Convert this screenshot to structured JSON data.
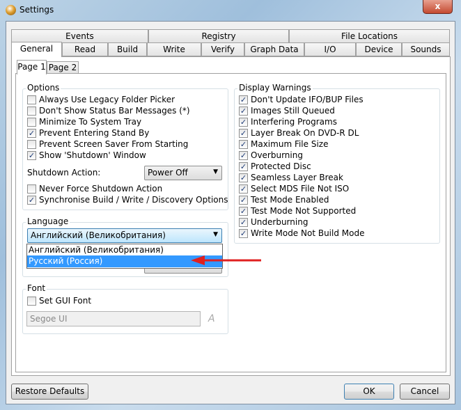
{
  "window": {
    "title": "Settings",
    "close_label": "x"
  },
  "tabs_row1": [
    "Events",
    "Registry",
    "File Locations"
  ],
  "tabs_row2": [
    "General",
    "Read",
    "Build",
    "Write",
    "Verify",
    "Graph Data",
    "I/O",
    "Device",
    "Sounds"
  ],
  "active_tab": "General",
  "subtabs": [
    "Page 1",
    "Page 2"
  ],
  "active_subtab": "Page 1",
  "options": {
    "title": "Options",
    "items": [
      {
        "label": "Always Use Legacy Folder Picker",
        "checked": false
      },
      {
        "label": "Don't Show Status Bar Messages (*)",
        "checked": false
      },
      {
        "label": "Minimize To System Tray",
        "checked": false
      },
      {
        "label": "Prevent Entering Stand By",
        "checked": true
      },
      {
        "label": "Prevent Screen Saver From Starting",
        "checked": false
      },
      {
        "label": "Show 'Shutdown' Window",
        "checked": true
      }
    ],
    "shutdown_label": "Shutdown Action:",
    "shutdown_value": "Power Off",
    "items2": [
      {
        "label": "Never Force Shutdown Action",
        "checked": false
      },
      {
        "label": "Synchronise Build / Write / Discovery Options",
        "checked": true
      }
    ]
  },
  "display_warnings": {
    "title": "Display Warnings",
    "items": [
      {
        "label": "Don't Update IFO/BUP Files",
        "checked": true
      },
      {
        "label": "Images Still Queued",
        "checked": true
      },
      {
        "label": "Interfering Programs",
        "checked": true
      },
      {
        "label": "Layer Break On DVD-R DL",
        "checked": true
      },
      {
        "label": "Maximum File Size",
        "checked": true
      },
      {
        "label": "Overburning",
        "checked": true
      },
      {
        "label": "Protected Disc",
        "checked": true
      },
      {
        "label": "Seamless Layer Break",
        "checked": true
      },
      {
        "label": "Select MDS File Not ISO",
        "checked": true
      },
      {
        "label": "Test Mode Enabled",
        "checked": true
      },
      {
        "label": "Test Mode Not Supported",
        "checked": true
      },
      {
        "label": "Underburning",
        "checked": true
      },
      {
        "label": "Write Mode Not Build Mode",
        "checked": true
      }
    ]
  },
  "language": {
    "title": "Language",
    "value": "Английский (Великобритания)",
    "options": [
      "Английский (Великобритания)",
      "Русский (Россия)"
    ],
    "highlighted": "Русский (Россия)"
  },
  "font": {
    "title": "Font",
    "set_gui_font_label": "Set GUI Font",
    "set_gui_font_checked": false,
    "font_value": "Segoe UI"
  },
  "buttons": {
    "restore": "Restore Defaults",
    "ok": "OK",
    "cancel": "Cancel"
  },
  "colors": {
    "highlight": "#3399ff",
    "arrow": "#e02020"
  }
}
